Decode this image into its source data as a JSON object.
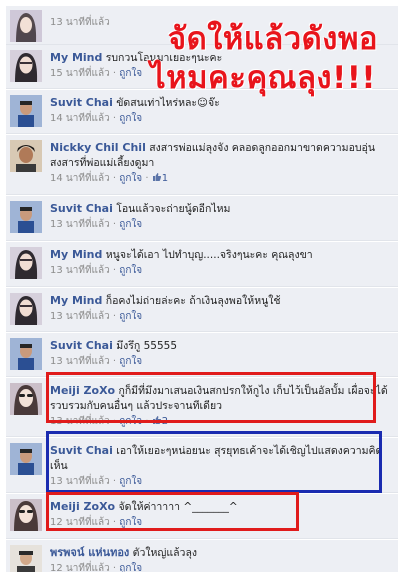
{
  "overlay": {
    "line1": "จัดให้แล้วดังพอ",
    "line2": "ไหมคะคุณลุง!!!"
  },
  "comments": [
    {
      "name": "",
      "text": "",
      "time": "13 นาทีที่แล้ว",
      "like": ""
    },
    {
      "name": "My Mind",
      "text": "รบกวนโอนมาเยอะๆนะคะ",
      "time": "15 นาทีที่แล้ว",
      "like": "ถูกใจ"
    },
    {
      "name": "Suvit Chai",
      "text": "ขัดสนเท่าไหร่หละ☺จ๊ะ",
      "time": "14 นาทีที่แล้ว",
      "like": "ถูกใจ"
    },
    {
      "name": "Nickky Chil Chil",
      "text": "สงสารพ่อแม่ลุงจัง คลอดลูกออกมาขาดความอบอุ่น สงสารที่พ่อแม่เลี้ยงดูมา",
      "time": "14 นาทีที่แล้ว",
      "like": "ถูกใจ",
      "likes": "1"
    },
    {
      "name": "Suvit Chai",
      "text": "โอนแล้วจะถ่ายนู้ดอีกไหม",
      "time": "13 นาทีที่แล้ว",
      "like": "ถูกใจ"
    },
    {
      "name": "My Mind",
      "text": "หนูจะได้เอา ไปทำบุญ.....จริงๆนะคะ คุณลุงขา",
      "time": "13 นาทีที่แล้ว",
      "like": "ถูกใจ"
    },
    {
      "name": "My Mind",
      "text": "ก็อคงไม่ถ่ายล่ะคะ ถ้าเงินลุงพอให้หนูใช้",
      "time": "13 นาทีที่แล้ว",
      "like": "ถูกใจ"
    },
    {
      "name": "Suvit Chai",
      "text": "มึงรึกู 55555",
      "time": "13 นาทีที่แล้ว",
      "like": "ถูกใจ"
    },
    {
      "name": "Meiji ZoXo",
      "text": "กูก็มีที่มึงมาเสนอเงินสกปรกให้กูไง เก็บไว้เป็นอัลบั้ม เผื่อจะได้รวบรวมกับคนอื่นๆ แล้วประจานทีเดียว",
      "time": "13 นาทีที่แล้ว",
      "like": "ถูกใจ",
      "likes": "2"
    },
    {
      "name": "Suvit Chai",
      "text": "เอาให้เยอะๆหน่อยนะ สุรยุทธเค้าจะได้เชิญไปแสดงความคิดเห็น",
      "time": "13 นาทีที่แล้ว",
      "like": "ถูกใจ"
    },
    {
      "name": "Meiji ZoXo",
      "text": "จัดให้ค่าาาาา ^_______^",
      "time": "12 นาทีที่แล้ว",
      "like": "ถูกใจ"
    },
    {
      "name": "พรพจน์ แห่นทอง",
      "text": "ตัวใหญ่แล้วลุง",
      "time": "12 นาทีที่แล้ว",
      "like": "ถูกใจ"
    }
  ],
  "colors": {
    "name": "#3b5998",
    "overlay": "#e8141b",
    "box_red": "#e01b1b",
    "box_blue": "#1a2bb0",
    "background": "#edeff4"
  }
}
